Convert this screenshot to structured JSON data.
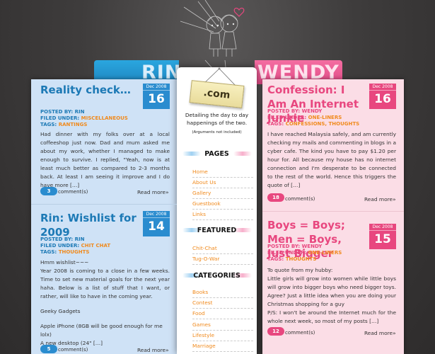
{
  "header": {
    "left_name": "RIN",
    "right_name": "WENDY",
    "sign_text": ".com",
    "tagline": "Detailing the day to day happenings of the two.",
    "note": "(Arguments not included)"
  },
  "posts_left": [
    {
      "title": "Reality check…",
      "month": "Dec 2008",
      "day": "16",
      "posted_by_label": "POSTED BY:",
      "posted_by": "RIN",
      "filed_label": "FILED UNDER:",
      "filed": "MISCELLANEOUS",
      "tags_label": "TAGS:",
      "tags": "RANTINGS",
      "excerpt": "Had dinner with my folks over at a local coffeeshop just now. Dad and mum asked me about my work, whether I managed to make enough to survive. I replied, \"Yeah, now is at least much better as compared to 2-3 months back. At least I am seeing it improve and I do have more […]",
      "comments": "3",
      "comment_label": "comment(s)",
      "read_more": "Read more»"
    },
    {
      "title": "Rin: Wishlist for 2009",
      "month": "Dec 2008",
      "day": "14",
      "posted_by_label": "POSTED BY:",
      "posted_by": "RIN",
      "filed_label": "FILED UNDER:",
      "filed": "CHIT CHAT",
      "tags_label": "TAGS:",
      "tags": "THOUGHTS",
      "excerpt_lines": [
        "Hmm wishlist~~~",
        "Year 2008 is coming to a close in a few weeks. Time to set new material goals for the next year haha. Below is a list of stuff that I want, or rather, will like to have in the coming year.",
        "Geeky Gadgets",
        "Apple iPhone (8GB will be good enough for me lolx)",
        "A new desktop (24\" […]"
      ],
      "comments": "5",
      "comment_label": "comment(s)",
      "read_more": "Read more»"
    }
  ],
  "posts_right": [
    {
      "title": "Confession: I Am An Internet Junkie",
      "month": "Dec 2008",
      "day": "16",
      "posted_by_label": "POSTED BY:",
      "posted_by": "WENDY",
      "filed_label": "FILED UNDER:",
      "filed": "ONE-LINERS",
      "tags_label": "TAGS:",
      "tags": "CONFESSIONS, THOUGHTS",
      "excerpt": "I have reached Malaysia safely, and am currently checking my mails and commenting in blogs in a cyber cafe. The kind you have to pay $1.20 per hour for. All because my house has no internet connection and I'm desperate to be connected to the rest of the world. Hence this triggers the quote of […]",
      "comments": "18",
      "comment_label": "comment(s)",
      "read_more": "Read more»"
    },
    {
      "title": "Boys = Boys; Men = Boys, Just Bigger",
      "month": "Dec 2008",
      "day": "15",
      "posted_by_label": "POSTED BY:",
      "posted_by": "WENDY",
      "filed_label": "FILED UNDER:",
      "filed": "ONE-LINERS",
      "tags_label": "TAGS:",
      "tags": "THOUGHTS",
      "excerpt_lines": [
        "To quote from my hubby:",
        "Little girls will grow into women while little boys will grow into bigger boys who need bigger toys. Agree? Just a little idea when you are doing your Christmas shopping for a guy",
        "P/S: I won't be around the Internet much for the whole next week, so most of my posts […]"
      ],
      "comments": "12",
      "comment_label": "comment(s)",
      "read_more": "Read more»"
    }
  ],
  "sidebar": {
    "pages_heading": "PAGES",
    "pages": [
      "Home",
      "About Us",
      "Gallery",
      "Guestbook",
      "Links"
    ],
    "featured_heading": "FEATURED",
    "featured": [
      "Chit-Chat",
      "Tug-O-War"
    ],
    "categories_heading": "CATEGORIES",
    "categories": [
      "Books",
      "Contest",
      "Food",
      "Games",
      "Lifestyle",
      "Marriage"
    ]
  },
  "colors": {
    "rin_blue": "#2a8ccf",
    "wendy_pink": "#e8477f",
    "link_orange": "#f08a1d"
  }
}
